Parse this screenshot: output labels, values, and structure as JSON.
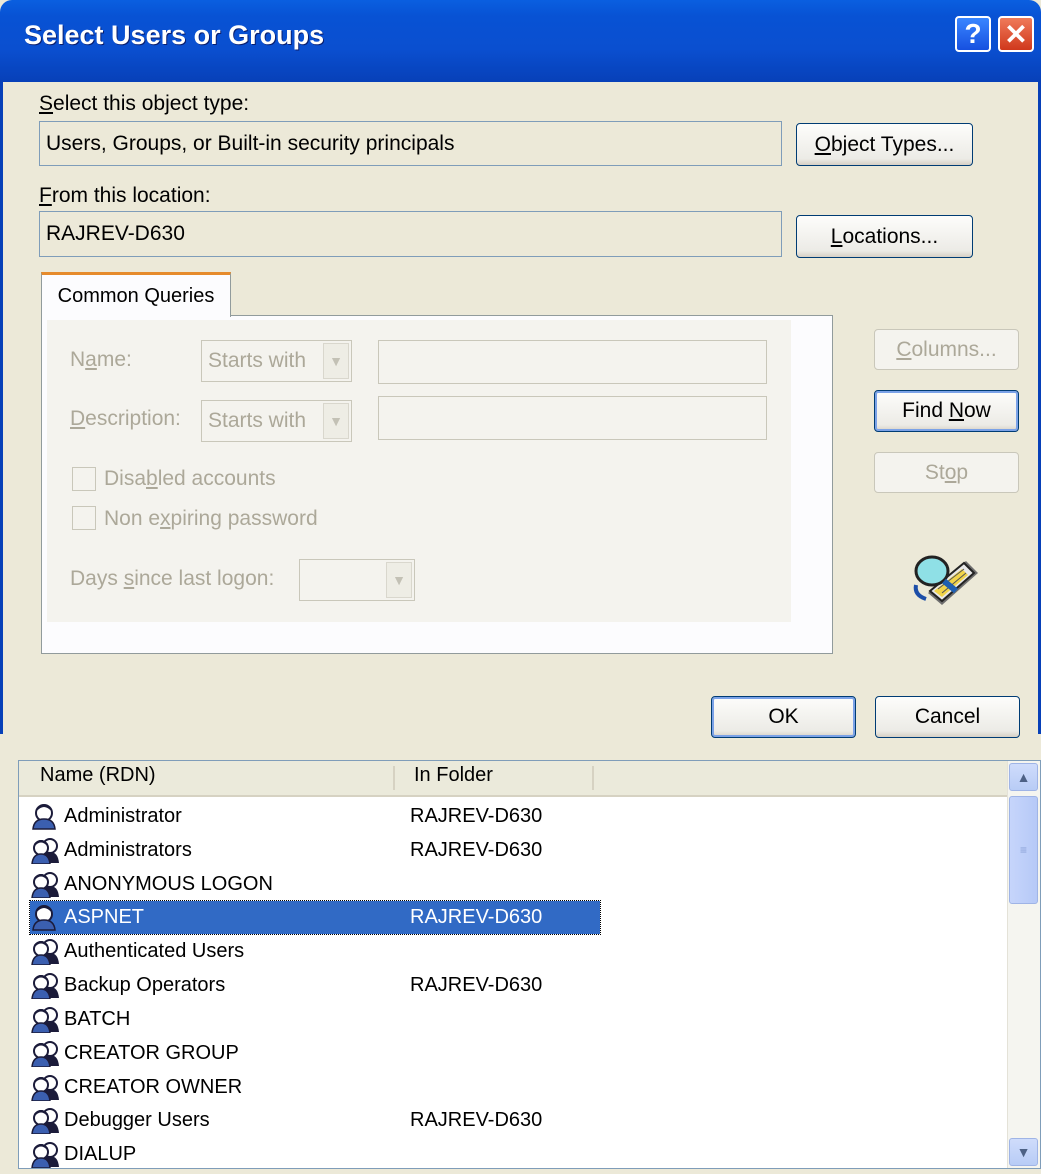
{
  "window": {
    "title": "Select Users or Groups",
    "help_glyph": "?",
    "close_glyph": "✕"
  },
  "object_type": {
    "label_prefix": "",
    "label_hotkey": "S",
    "label_rest": "elect this object type:",
    "value": "Users, Groups, or Built-in security principals",
    "button_hotkey": "O",
    "button_rest": "bject Types..."
  },
  "location": {
    "label_hotkey": "F",
    "label_rest": "rom this location:",
    "value": "RAJREV-D630",
    "button_hotkey": "L",
    "button_rest": "ocations..."
  },
  "queries": {
    "tab_label": "Common Queries",
    "name_label_pre": "N",
    "name_label_hot": "a",
    "name_label_post": "me:",
    "name_combo": "Starts with",
    "desc_label_hot": "D",
    "desc_label_post": "escription:",
    "desc_combo": "Starts with",
    "disabled_pre": "Disa",
    "disabled_hot": "b",
    "disabled_post": "led accounts",
    "nonexp_pre": "Non e",
    "nonexp_hot": "x",
    "nonexp_post": "piring password",
    "days_pre": "Days ",
    "days_hot": "s",
    "days_post": "ince last logon:"
  },
  "side_buttons": {
    "columns_hot": "C",
    "columns_rest": "olumns...",
    "find_pre": "Find ",
    "find_hot": "N",
    "find_post": "ow",
    "stop_pre": "St",
    "stop_hot": "o",
    "stop_post": "p"
  },
  "actions": {
    "ok": "OK",
    "cancel": "Cancel"
  },
  "results": {
    "columns": [
      "Name (RDN)",
      "In Folder"
    ],
    "rows": [
      {
        "name": "Administrator",
        "folder": "RAJREV-D630",
        "icon": "user-icon"
      },
      {
        "name": "Administrators",
        "folder": "RAJREV-D630",
        "icon": "group-icon"
      },
      {
        "name": "ANONYMOUS LOGON",
        "folder": "",
        "icon": "group-icon"
      },
      {
        "name": "ASPNET",
        "folder": "RAJREV-D630",
        "icon": "user-icon",
        "selected": true
      },
      {
        "name": "Authenticated Users",
        "folder": "",
        "icon": "group-icon"
      },
      {
        "name": "Backup Operators",
        "folder": "RAJREV-D630",
        "icon": "group-icon"
      },
      {
        "name": "BATCH",
        "folder": "",
        "icon": "group-icon"
      },
      {
        "name": "CREATOR GROUP",
        "folder": "",
        "icon": "group-icon"
      },
      {
        "name": "CREATOR OWNER",
        "folder": "",
        "icon": "group-icon"
      },
      {
        "name": "Debugger Users",
        "folder": "RAJREV-D630",
        "icon": "group-icon"
      },
      {
        "name": "DIALUP",
        "folder": "",
        "icon": "group-icon"
      }
    ]
  },
  "colors": {
    "title_bar": "#0a4fd0",
    "dialog_bg": "#ece9d8",
    "selection": "#316ac5",
    "tab_accent": "#e68b2c"
  }
}
